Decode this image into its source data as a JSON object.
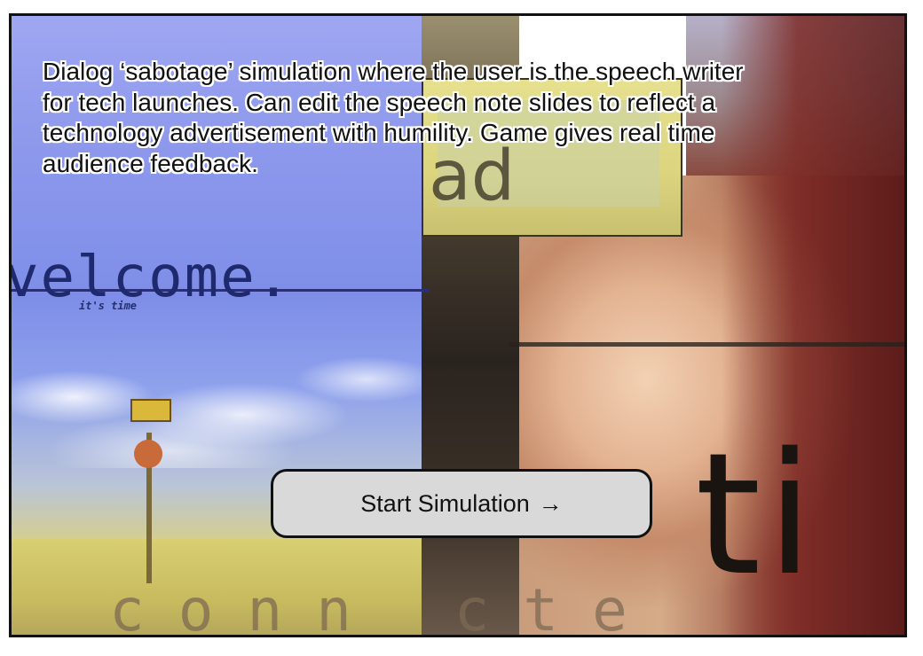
{
  "intro": {
    "description": "Dialog ‘sabotage’  simulation where the user is the speech writer for tech launches. Can edit the speech note slides to reflect a technology advertisement with humility. Game gives real time audience feedback."
  },
  "background": {
    "welcome_text": "velcome.",
    "welcome_subtext": "it's time",
    "bottom_text": "conn cte",
    "right_text": "ti",
    "panel_text": "ad"
  },
  "actions": {
    "start_label": "Start Simulation",
    "start_arrow": "→"
  }
}
